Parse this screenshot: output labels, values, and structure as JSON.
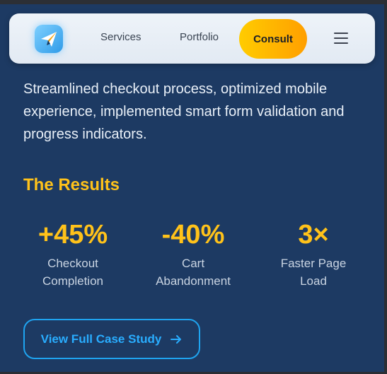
{
  "nav": {
    "logo_icon": "paper-plane-icon",
    "links": [
      {
        "label": "Services"
      },
      {
        "label": "Portfolio"
      }
    ],
    "cta_label": "Consult",
    "menu_icon": "hamburger-menu-icon"
  },
  "content": {
    "description": "Streamlined checkout process, optimized mobile experience, implemented smart form validation and progress indicators.",
    "results_title": "The Results",
    "stats": [
      {
        "value": "+45%",
        "label_line1": "Checkout",
        "label_line2": "Completion"
      },
      {
        "value": "-40%",
        "label_line1": "Cart",
        "label_line2": "Abandonment"
      },
      {
        "value": "3×",
        "label_line1": "Faster Page",
        "label_line2": "Load"
      }
    ],
    "cta": {
      "label": "View Full Case Study",
      "icon": "arrow-right-icon"
    }
  },
  "colors": {
    "background": "#1d3a63",
    "accent_yellow": "#ffc21a",
    "cta_orange_start": "#ffcc00",
    "cta_orange_end": "#ff9f00",
    "link_blue": "#29adff"
  }
}
